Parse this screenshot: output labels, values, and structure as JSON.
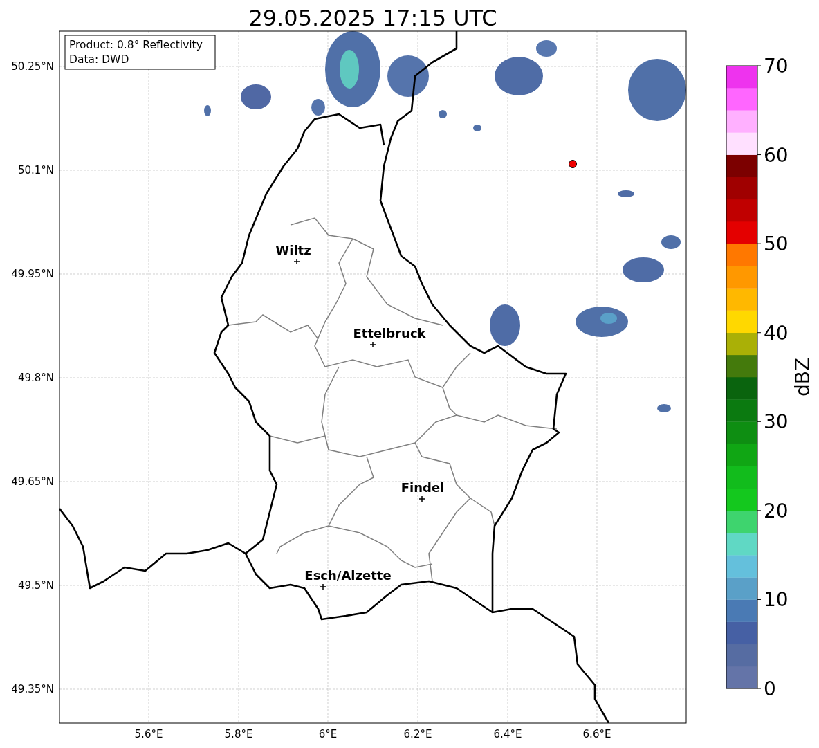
{
  "title": "29.05.2025 17:15 UTC",
  "info_box": {
    "lines": [
      "Product: 0.8° Reflectivity",
      "Data: DWD"
    ]
  },
  "map": {
    "y_ticks": [
      "50.25°N",
      "50.1°N",
      "49.95°N",
      "49.8°N",
      "49.65°N",
      "49.5°N",
      "49.35°N"
    ],
    "x_ticks": [
      "5.6°E",
      "5.8°E",
      "6°E",
      "6.2°E",
      "6.4°E",
      "6.6°E"
    ],
    "cities": [
      {
        "name": "Wiltz"
      },
      {
        "name": "Ettelbruck"
      },
      {
        "name": "Findel"
      },
      {
        "name": "Esch/Alzette"
      }
    ]
  },
  "colorbar": {
    "label": "dBZ",
    "ticks": [
      "70",
      "60",
      "50",
      "40",
      "30",
      "20",
      "10",
      "0"
    ],
    "bands": [
      {
        "color": "#6474a8"
      },
      {
        "color": "#566ca2"
      },
      {
        "color": "#4660a4"
      },
      {
        "color": "#4a7ab4"
      },
      {
        "color": "#5aa0c8"
      },
      {
        "color": "#64c0dc"
      },
      {
        "color": "#60d8c4"
      },
      {
        "color": "#3ed46e"
      },
      {
        "color": "#14c81e"
      },
      {
        "color": "#12bc1c"
      },
      {
        "color": "#10a614"
      },
      {
        "color": "#0e8e12"
      },
      {
        "color": "#0b7a10"
      },
      {
        "color": "#0a640e"
      },
      {
        "color": "#447a0c"
      },
      {
        "color": "#aab006"
      },
      {
        "color": "#ffd800"
      },
      {
        "color": "#ffb800"
      },
      {
        "color": "#ff9800"
      },
      {
        "color": "#ff7800"
      },
      {
        "color": "#e40000"
      },
      {
        "color": "#c00000"
      },
      {
        "color": "#a00000"
      },
      {
        "color": "#7c0000"
      },
      {
        "color": "#ffe0ff"
      },
      {
        "color": "#ffb0ff"
      },
      {
        "color": "#ff66ff"
      },
      {
        "color": "#ee33ee"
      }
    ]
  }
}
